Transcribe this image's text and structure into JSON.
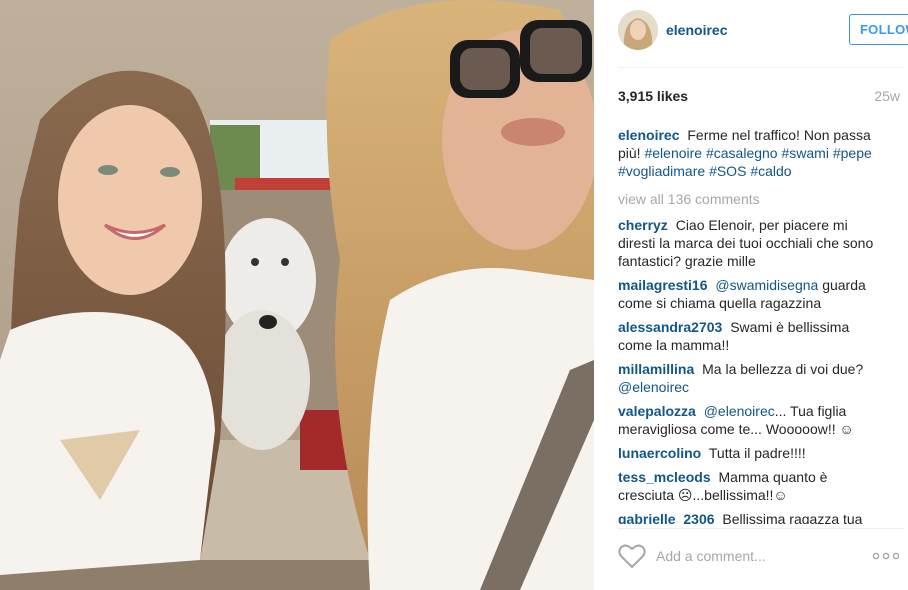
{
  "post": {
    "username": "elenoirec",
    "follow_label": "FOLLOW",
    "likes": "3,915 likes",
    "age": "25w"
  },
  "caption": {
    "author": "elenoirec",
    "text": "Ferme nel traffico! Non passa più!",
    "tags": [
      "#elenoire",
      "#casalegno",
      "#swami",
      "#pepe",
      "#vogliadimare",
      "#SOS",
      "#caldo"
    ]
  },
  "view_all": "view all 136 comments",
  "comments": [
    {
      "author": "cherryz",
      "text": "Ciao Elenoir, per piacere mi diresti la marca dei tuoi occhiali che sono fantastici? grazie mille"
    },
    {
      "author": "mailagresti16",
      "mention": "@swamidisegna",
      "text": "guarda come si chiama quella ragazzina"
    },
    {
      "author": "alessandra2703",
      "text": "Swami è bellissima come la mamma!!"
    },
    {
      "author": "millamillina",
      "text": "Ma la bellezza di voi due?",
      "mention": "@elenoirec"
    },
    {
      "author": "valepalozza",
      "mention": "@elenoirec",
      "text": "... Tua figlia meravigliosa come te... Wooooow!! ☺"
    },
    {
      "author": "lunaercolino",
      "text": "Tutta il padre!!!!"
    },
    {
      "author": "tess_mcleods",
      "text": "Mamma quanto è cresciuta ☹...bellissima!!☺"
    },
    {
      "author": "gabrielle_2306",
      "text": "Bellissima ragazza tua"
    }
  ],
  "footer": {
    "placeholder": "Add a comment..."
  },
  "icons": {
    "like": "heart-outline-icon",
    "more": "ellipsis-icon"
  },
  "colors": {
    "link": "#125688",
    "follow": "#3897f0",
    "muted": "#a5a7aa"
  }
}
